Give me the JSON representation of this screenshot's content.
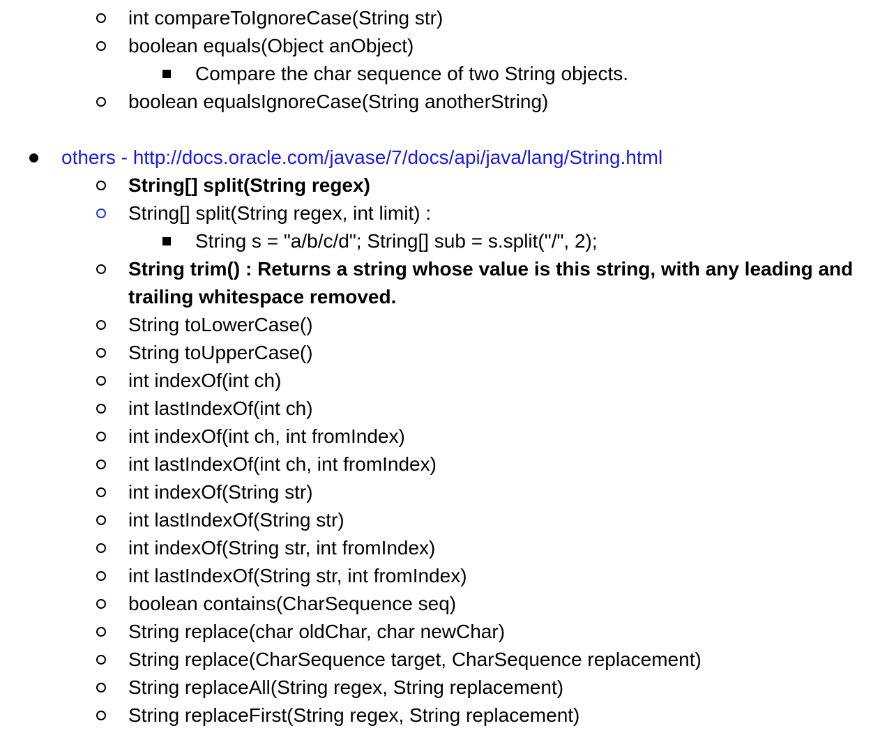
{
  "items": {
    "compareToIgnoreCase": "int compareToIgnoreCase(String str)",
    "equals": "boolean equals(Object anObject)",
    "equals_note": "Compare the char sequence of two String objects.",
    "equalsIgnoreCase": "boolean equalsIgnoreCase(String anotherString)",
    "others": "others - http://docs.oracle.com/javase/7/docs/api/java/lang/String.html",
    "split1": "String[] split(String regex)",
    "split2": "String[] split(String regex, int limit) :",
    "split2_example": "String s = \"a/b/c/d\"; String[] sub = s.split(\"/\", 2);",
    "trim": "String trim() : Returns a string whose value is this string, with any leading and trailing whitespace removed.",
    "toLowerCase": "String toLowerCase()",
    "toUpperCase": "String toUpperCase()",
    "indexOf_ch": "int indexOf(int ch)",
    "lastIndexOf_ch": "int lastIndexOf(int ch)",
    "indexOf_ch_from": "int indexOf(int ch, int fromIndex)",
    "lastIndexOf_ch_from": "int lastIndexOf(int ch, int fromIndex)",
    "indexOf_str": "int indexOf(String str)",
    "lastIndexOf_str": "int lastIndexOf(String str)",
    "indexOf_str_from": "int indexOf(String str, int fromIndex)",
    "lastIndexOf_str_from": "int lastIndexOf(String str, int fromIndex)",
    "contains": "boolean contains(CharSequence seq)",
    "replace_char": "String replace(char oldChar, char newChar)",
    "replace_seq": "String replace(CharSequence target, CharSequence replacement)",
    "replaceAll": "String replaceAll(String regex, String replacement)",
    "replaceFirst": "String replaceFirst(String regex, String replacement)"
  },
  "colors": {
    "link": "#1a1ae6",
    "text": "#000000",
    "blue_bullet": "#1a3bd8"
  },
  "icons": {
    "level1": "filled-disc-bullet",
    "level2": "hollow-circle-bullet",
    "level3": "filled-square-bullet"
  }
}
